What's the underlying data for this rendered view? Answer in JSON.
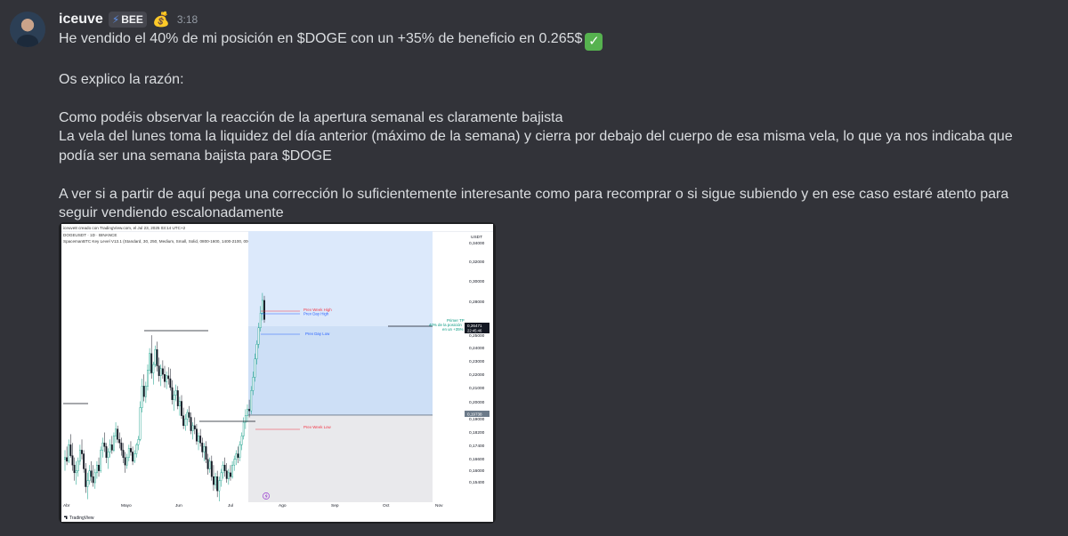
{
  "user": {
    "name": "iceuve",
    "tag_icon": "bolt-icon",
    "tag": "BEE",
    "badge_icon": "money-bag-emoji",
    "timestamp": "3:18"
  },
  "message": {
    "line1": "He vendido el 40% de mi posición en $DOGE con un +35% de beneficio en 0.265$",
    "line1_emoji": "check-mark-emoji",
    "line2": "Os explico la razón:",
    "para1_line1": "Como podéis observar la reacción de la apertura semanal es claramente bajista",
    "para1_line2": "La vela del lunes toma la liquidez del día anterior (máximo de la semana) y cierra por debajo del cuerpo de esa misma vela, lo que ya nos indicaba que podía ser una semana bajista para $DOGE",
    "para2": "A ver si a partir de aquí pega una corrección lo suficientemente interesante como para recomprar o si sigue subiendo y en ese caso estaré atento para seguir vendiendo escalonadamente"
  },
  "chart": {
    "header_line1": "iceuve8 creado con TradingView.com, el Jul 23, 2025 03:14 UTC+2",
    "header_line2": "DOGEUSDT · 1D · BINANCE",
    "header_line3": "SpacemanBTC Key Level V13.1 (Standard, 30, 250, Medium, Small, Solid, 0800-1600, 1400-2100, 0000-0900)",
    "currency": "USDT",
    "label_prev_week_high": "Prev Week High",
    "label_prev_day_high": "Prev Day High",
    "label_prev_day_low": "Prev Day Low",
    "label_prev_week_low": "Prev Week Low",
    "note_line1": "Primer TP",
    "note_line2": "40% de la posición",
    "note_line3": "en un +35%",
    "price_tag": "0,26471",
    "price_tag_time": "22:45:46",
    "entry_tag": "0,19738",
    "footer": "TradingView",
    "colors": {
      "up": "#089981",
      "down": "#131722",
      "target_zone": "#dce9fb",
      "profit_zone": "#cddff6",
      "stop_zone": "#e9e9ec",
      "level_red": "#f23645",
      "level_blue": "#2962ff"
    }
  },
  "chart_data": {
    "type": "candlestick",
    "symbol": "DOGEUSDT",
    "interval": "1D",
    "x_tick_labels": [
      "Abr",
      "Mayo",
      "Jun",
      "Jul",
      "Ago",
      "Sep",
      "Oct",
      "Nov"
    ],
    "y_tick_labels": [
      "0,34000",
      "0,32000",
      "0,30000",
      "0,28000",
      "0,25000",
      "0,24000",
      "0,23000",
      "0,22000",
      "0,21000",
      "0,20000",
      "0,19000",
      "0,18200",
      "0,17400",
      "0,16600",
      "0,16000",
      "0,15400"
    ],
    "ylim": [
      0.15,
      0.345
    ],
    "y_scale": "log",
    "levels": {
      "prev_week_high": 0.2876,
      "prev_day_high": 0.2845,
      "prev_day_low": 0.264,
      "prev_week_low": 0.19
    },
    "position": {
      "entry": 0.19738,
      "target": 0.2647,
      "stop": 0.155,
      "current_price": 0.26471
    },
    "candles": [
      [
        0.171,
        0.176,
        0.165,
        0.172
      ],
      [
        0.172,
        0.178,
        0.168,
        0.17
      ],
      [
        0.17,
        0.182,
        0.169,
        0.179
      ],
      [
        0.179,
        0.185,
        0.172,
        0.173
      ],
      [
        0.173,
        0.18,
        0.165,
        0.168
      ],
      [
        0.168,
        0.172,
        0.16,
        0.164
      ],
      [
        0.164,
        0.17,
        0.158,
        0.165
      ],
      [
        0.165,
        0.172,
        0.162,
        0.17
      ],
      [
        0.17,
        0.179,
        0.168,
        0.176
      ],
      [
        0.176,
        0.182,
        0.171,
        0.174
      ],
      [
        0.174,
        0.176,
        0.164,
        0.166
      ],
      [
        0.166,
        0.169,
        0.154,
        0.157
      ],
      [
        0.157,
        0.164,
        0.151,
        0.16
      ],
      [
        0.16,
        0.168,
        0.158,
        0.165
      ],
      [
        0.165,
        0.17,
        0.159,
        0.162
      ],
      [
        0.162,
        0.168,
        0.157,
        0.159
      ],
      [
        0.159,
        0.166,
        0.156,
        0.164
      ],
      [
        0.164,
        0.17,
        0.161,
        0.168
      ],
      [
        0.168,
        0.172,
        0.162,
        0.165
      ],
      [
        0.165,
        0.178,
        0.164,
        0.176
      ],
      [
        0.176,
        0.183,
        0.172,
        0.18
      ],
      [
        0.18,
        0.186,
        0.175,
        0.178
      ],
      [
        0.178,
        0.18,
        0.169,
        0.172
      ],
      [
        0.172,
        0.177,
        0.166,
        0.175
      ],
      [
        0.175,
        0.182,
        0.172,
        0.179
      ],
      [
        0.179,
        0.184,
        0.174,
        0.176
      ],
      [
        0.176,
        0.186,
        0.175,
        0.184
      ],
      [
        0.184,
        0.192,
        0.18,
        0.188
      ],
      [
        0.188,
        0.19,
        0.18,
        0.182
      ],
      [
        0.182,
        0.186,
        0.177,
        0.18
      ],
      [
        0.18,
        0.183,
        0.173,
        0.176
      ],
      [
        0.176,
        0.18,
        0.169,
        0.172
      ],
      [
        0.172,
        0.175,
        0.164,
        0.168
      ],
      [
        0.168,
        0.174,
        0.166,
        0.172
      ],
      [
        0.172,
        0.179,
        0.17,
        0.177
      ],
      [
        0.177,
        0.181,
        0.173,
        0.175
      ],
      [
        0.175,
        0.178,
        0.168,
        0.17
      ],
      [
        0.17,
        0.176,
        0.169,
        0.174
      ],
      [
        0.174,
        0.18,
        0.172,
        0.179
      ],
      [
        0.179,
        0.184,
        0.176,
        0.182
      ],
      [
        0.182,
        0.205,
        0.181,
        0.201
      ],
      [
        0.201,
        0.22,
        0.198,
        0.215
      ],
      [
        0.215,
        0.223,
        0.205,
        0.208
      ],
      [
        0.208,
        0.218,
        0.204,
        0.215
      ],
      [
        0.215,
        0.23,
        0.212,
        0.226
      ],
      [
        0.226,
        0.242,
        0.223,
        0.238
      ],
      [
        0.238,
        0.252,
        0.22,
        0.224
      ],
      [
        0.224,
        0.232,
        0.216,
        0.23
      ],
      [
        0.23,
        0.244,
        0.228,
        0.241
      ],
      [
        0.241,
        0.247,
        0.225,
        0.229
      ],
      [
        0.229,
        0.235,
        0.218,
        0.222
      ],
      [
        0.222,
        0.23,
        0.215,
        0.227
      ],
      [
        0.227,
        0.233,
        0.22,
        0.223
      ],
      [
        0.223,
        0.229,
        0.214,
        0.218
      ],
      [
        0.218,
        0.225,
        0.213,
        0.222
      ],
      [
        0.222,
        0.228,
        0.216,
        0.22
      ],
      [
        0.22,
        0.227,
        0.212,
        0.214
      ],
      [
        0.214,
        0.219,
        0.203,
        0.206
      ],
      [
        0.206,
        0.212,
        0.199,
        0.209
      ],
      [
        0.209,
        0.216,
        0.205,
        0.212
      ],
      [
        0.212,
        0.215,
        0.2,
        0.202
      ],
      [
        0.202,
        0.208,
        0.196,
        0.205
      ],
      [
        0.205,
        0.209,
        0.194,
        0.196
      ],
      [
        0.196,
        0.201,
        0.188,
        0.19
      ],
      [
        0.19,
        0.197,
        0.187,
        0.194
      ],
      [
        0.194,
        0.2,
        0.19,
        0.198
      ],
      [
        0.198,
        0.202,
        0.192,
        0.195
      ],
      [
        0.195,
        0.198,
        0.185,
        0.187
      ],
      [
        0.187,
        0.192,
        0.182,
        0.19
      ],
      [
        0.19,
        0.195,
        0.185,
        0.188
      ],
      [
        0.188,
        0.191,
        0.179,
        0.181
      ],
      [
        0.181,
        0.186,
        0.176,
        0.184
      ],
      [
        0.184,
        0.188,
        0.178,
        0.18
      ],
      [
        0.18,
        0.183,
        0.172,
        0.175
      ],
      [
        0.175,
        0.18,
        0.17,
        0.178
      ],
      [
        0.178,
        0.181,
        0.169,
        0.171
      ],
      [
        0.171,
        0.174,
        0.163,
        0.166
      ],
      [
        0.166,
        0.172,
        0.164,
        0.17
      ],
      [
        0.17,
        0.173,
        0.16,
        0.162
      ],
      [
        0.162,
        0.168,
        0.155,
        0.158
      ],
      [
        0.158,
        0.164,
        0.156,
        0.162
      ],
      [
        0.162,
        0.165,
        0.152,
        0.155
      ],
      [
        0.155,
        0.162,
        0.15,
        0.16
      ],
      [
        0.16,
        0.166,
        0.157,
        0.164
      ],
      [
        0.164,
        0.17,
        0.161,
        0.168
      ],
      [
        0.168,
        0.172,
        0.162,
        0.165
      ],
      [
        0.165,
        0.169,
        0.159,
        0.161
      ],
      [
        0.161,
        0.166,
        0.158,
        0.164
      ],
      [
        0.164,
        0.168,
        0.16,
        0.162
      ],
      [
        0.162,
        0.17,
        0.161,
        0.168
      ],
      [
        0.168,
        0.173,
        0.165,
        0.171
      ],
      [
        0.171,
        0.176,
        0.168,
        0.174
      ],
      [
        0.174,
        0.178,
        0.169,
        0.172
      ],
      [
        0.172,
        0.181,
        0.17,
        0.179
      ],
      [
        0.179,
        0.186,
        0.176,
        0.184
      ],
      [
        0.184,
        0.195,
        0.182,
        0.192
      ],
      [
        0.192,
        0.2,
        0.188,
        0.196
      ],
      [
        0.196,
        0.203,
        0.192,
        0.2
      ],
      [
        0.2,
        0.206,
        0.195,
        0.199
      ],
      [
        0.199,
        0.215,
        0.197,
        0.212
      ],
      [
        0.212,
        0.225,
        0.209,
        0.221
      ],
      [
        0.221,
        0.238,
        0.218,
        0.234
      ],
      [
        0.234,
        0.248,
        0.23,
        0.245
      ],
      [
        0.245,
        0.262,
        0.242,
        0.258
      ],
      [
        0.258,
        0.276,
        0.255,
        0.27
      ],
      [
        0.27,
        0.2876,
        0.264,
        0.281
      ],
      [
        0.281,
        0.285,
        0.262,
        0.2647
      ]
    ]
  }
}
